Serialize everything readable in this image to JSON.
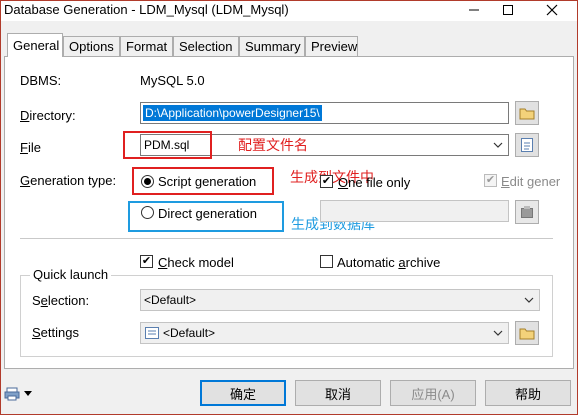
{
  "window": {
    "title": "Database Generation - LDM_Mysql (LDM_Mysql)",
    "minimize_icon": "minimize-icon",
    "maximize_icon": "maximize-icon",
    "close_icon": "close-icon"
  },
  "tabs": [
    {
      "label": "General",
      "active": true
    },
    {
      "label": "Options"
    },
    {
      "label": "Format"
    },
    {
      "label": "Selection"
    },
    {
      "label": "Summary"
    },
    {
      "label": "Preview"
    }
  ],
  "general": {
    "dbms_label": "DBMS:",
    "dbms_value": "MySQL 5.0",
    "directory_label_hot": "D",
    "directory_label_rest": "irectory:",
    "directory_value": "D:\\Application\\powerDesigner15\\",
    "file_label_hot": "F",
    "file_label_rest": "ile",
    "file_value": "PDM.sql",
    "file_annotation": "配置文件名",
    "generation_type_label_hot": "G",
    "generation_type_label_rest": "eneration type:",
    "script_generation_label": "Script generation",
    "script_generation_selected": true,
    "script_annotation": "生成到文件中",
    "one_file_only_label_hot": "O",
    "one_file_only_label_rest": "ne file only",
    "one_file_only_checked": true,
    "edit_generation_label_hot": "E",
    "edit_generation_label_rest": "dit gener",
    "edit_generation_checked": true,
    "direct_generation_label": "Direct generation",
    "direct_annotation": "生成到数据库",
    "check_model_label_hot": "C",
    "check_model_label_rest": "heck model",
    "check_model_checked": true,
    "automatic_archive_label_pre": "Automatic ",
    "automatic_archive_label_hot": "a",
    "automatic_archive_label_rest": "rchive",
    "automatic_archive_checked": false
  },
  "quick_launch": {
    "title": "Quick launch",
    "selection_label_pre": "S",
    "selection_label_hot": "e",
    "selection_label_rest": "lection:",
    "selection_value": "<Default>",
    "settings_label_hot": "S",
    "settings_label_rest": "ettings",
    "settings_value": "<Default>"
  },
  "footer": {
    "ok_label": "确定",
    "cancel_label": "取消",
    "apply_label": "应用(A)",
    "help_label": "帮助"
  },
  "colors": {
    "annotation_red": "#e02020",
    "annotation_blue": "#1e9be0",
    "selection_blue": "#0078d7"
  }
}
